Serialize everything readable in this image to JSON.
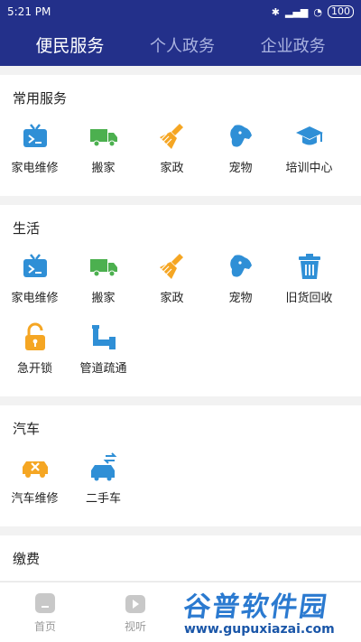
{
  "status_bar": {
    "time": "5:21 PM",
    "battery": "100"
  },
  "top_tabs": [
    {
      "label": "便民服务",
      "active": true
    },
    {
      "label": "个人政务",
      "active": false
    },
    {
      "label": "企业政务",
      "active": false
    }
  ],
  "sections": [
    {
      "title": "常用服务",
      "items": [
        {
          "label": "家电维修",
          "icon": "tv-repair-icon"
        },
        {
          "label": "搬家",
          "icon": "truck-icon"
        },
        {
          "label": "家政",
          "icon": "broom-icon"
        },
        {
          "label": "宠物",
          "icon": "dog-icon"
        },
        {
          "label": "培训中心",
          "icon": "graduation-cap-icon"
        }
      ]
    },
    {
      "title": "生活",
      "items": [
        {
          "label": "家电维修",
          "icon": "tv-repair-icon"
        },
        {
          "label": "搬家",
          "icon": "truck-icon"
        },
        {
          "label": "家政",
          "icon": "broom-icon"
        },
        {
          "label": "宠物",
          "icon": "dog-icon"
        },
        {
          "label": "旧货回收",
          "icon": "trash-bin-icon"
        },
        {
          "label": "急开锁",
          "icon": "unlock-icon"
        },
        {
          "label": "管道疏通",
          "icon": "pipe-icon"
        }
      ]
    },
    {
      "title": "汽车",
      "items": [
        {
          "label": "汽车维修",
          "icon": "car-repair-icon"
        },
        {
          "label": "二手车",
          "icon": "car-exchange-icon"
        }
      ]
    },
    {
      "title": "缴费",
      "items": []
    }
  ],
  "tab_bar": [
    {
      "label": "首页",
      "icon": "home-icon"
    },
    {
      "label": "视听",
      "icon": "play-icon"
    }
  ],
  "watermark": {
    "title": "谷普软件园",
    "url": "www.gupuxiazai.com"
  },
  "colors": {
    "header": "#23308a",
    "blue": "#2f8fd6",
    "green": "#4cb04f",
    "orange": "#f5a623",
    "section_bg": "#ffffff"
  }
}
